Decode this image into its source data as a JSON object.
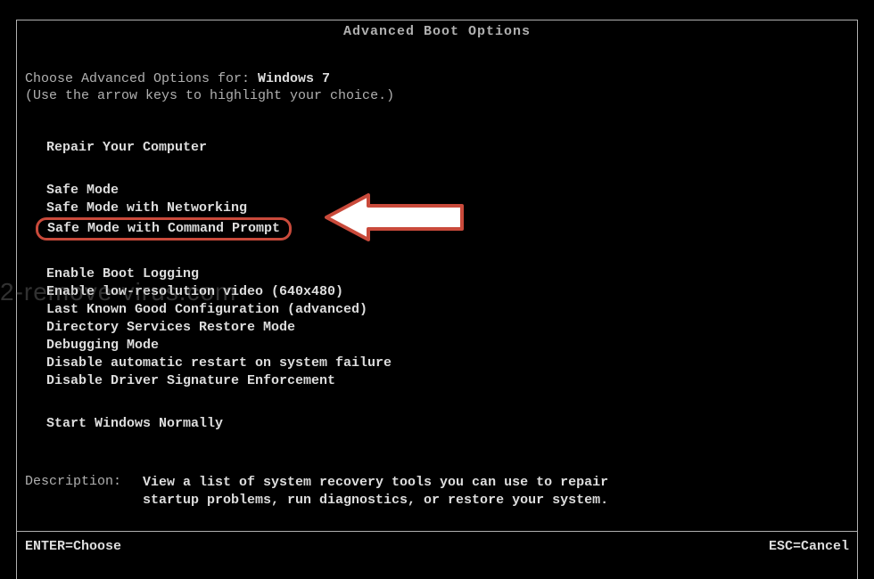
{
  "title": "Advanced Boot Options",
  "instructions": {
    "prefix": "Choose Advanced Options for: ",
    "os_name": "Windows 7",
    "hint": "(Use the arrow keys to highlight your choice.)"
  },
  "menu": {
    "group1": [
      "Repair Your Computer"
    ],
    "group2": [
      "Safe Mode",
      "Safe Mode with Networking",
      "Safe Mode with Command Prompt"
    ],
    "group3": [
      "Enable Boot Logging",
      "Enable low-resolution video (640x480)",
      "Last Known Good Configuration (advanced)",
      "Directory Services Restore Mode",
      "Debugging Mode",
      "Disable automatic restart on system failure",
      "Disable Driver Signature Enforcement"
    ],
    "group4": [
      "Start Windows Normally"
    ]
  },
  "description": {
    "label": "Description:",
    "text_line1": "View a list of system recovery tools you can use to repair",
    "text_line2": "startup problems, run diagnostics, or restore your system."
  },
  "footer": {
    "enter": "ENTER=Choose",
    "esc": "ESC=Cancel"
  },
  "watermark": "2-remove-virus.com"
}
